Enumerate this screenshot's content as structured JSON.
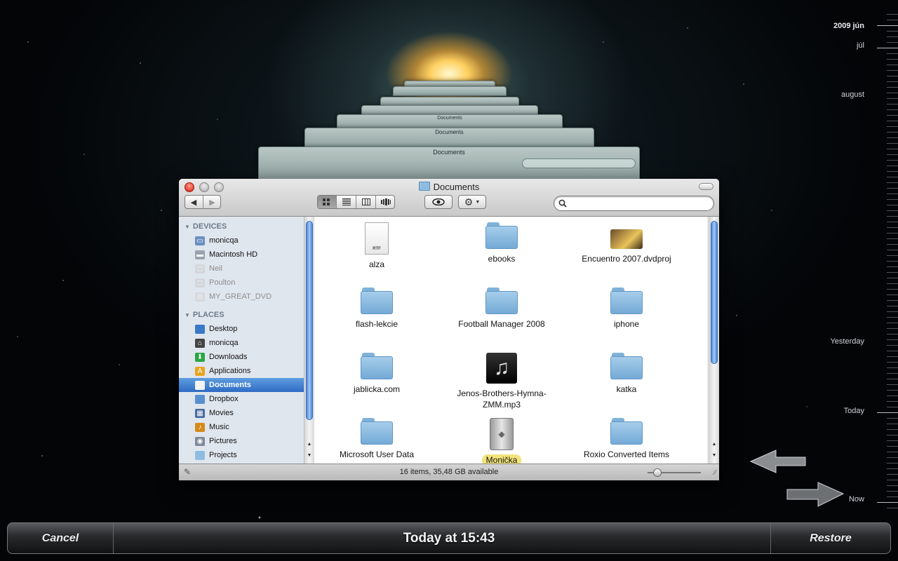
{
  "window": {
    "title": "Documents",
    "status": "16 items, 35,48 GB available"
  },
  "toolbar": {
    "back_icon": "◀",
    "forward_icon": "▶",
    "search_placeholder": ""
  },
  "sidebar": {
    "devices_header": "DEVICES",
    "devices": [
      {
        "label": "monicqa",
        "icon": "laptop-icon",
        "dim": false
      },
      {
        "label": "Macintosh HD",
        "icon": "harddisk-icon",
        "dim": false
      },
      {
        "label": "Neil",
        "icon": "disk-icon",
        "dim": true
      },
      {
        "label": "Poulton",
        "icon": "disk-icon",
        "dim": true
      },
      {
        "label": "MY_GREAT_DVD",
        "icon": "dvd-icon",
        "dim": true
      }
    ],
    "places_header": "PLACES",
    "places": [
      {
        "label": "Desktop",
        "icon": "desktop-icon"
      },
      {
        "label": "monicqa",
        "icon": "home-icon"
      },
      {
        "label": "Downloads",
        "icon": "downloads-icon"
      },
      {
        "label": "Applications",
        "icon": "applications-icon"
      },
      {
        "label": "Documents",
        "icon": "documents-icon",
        "selected": true
      },
      {
        "label": "Dropbox",
        "icon": "dropbox-icon"
      },
      {
        "label": "Movies",
        "icon": "movies-icon"
      },
      {
        "label": "Music",
        "icon": "music-icon"
      },
      {
        "label": "Pictures",
        "icon": "pictures-icon"
      },
      {
        "label": "Projects",
        "icon": "folder-icon"
      }
    ]
  },
  "files": [
    {
      "name": "alza",
      "icon": "rtf-file-icon",
      "badge": "RTF"
    },
    {
      "name": "ebooks",
      "icon": "folder-icon"
    },
    {
      "name": "Encuentro 2007.dvdproj",
      "icon": "dvdproj-file-icon"
    },
    {
      "name": "flash-lekcie",
      "icon": "folder-icon"
    },
    {
      "name": "Football Manager 2008",
      "icon": "folder-icon"
    },
    {
      "name": "iphone",
      "icon": "folder-icon"
    },
    {
      "name": "jablicka.com",
      "icon": "folder-icon"
    },
    {
      "name": "Jenos-Brothers-Hymna-ZMM.mp3",
      "name_line1": "Jenos-Brothers-Hymna-",
      "name_line2": "ZMM.mp3",
      "icon": "mp3-file-icon"
    },
    {
      "name": "katka",
      "icon": "folder-icon"
    },
    {
      "name": "Microsoft User Data",
      "icon": "folder-icon"
    },
    {
      "name": "Monička",
      "icon": "mac-pro-icon",
      "highlighted": true
    },
    {
      "name": "Roxio Converted Items",
      "icon": "folder-icon"
    }
  ],
  "timeline": {
    "labels": [
      {
        "text": "2009 jún",
        "year": true
      },
      {
        "text": "júl"
      },
      {
        "text": "august"
      },
      {
        "text": "Yesterday"
      },
      {
        "text": "Today"
      },
      {
        "text": "Now"
      }
    ]
  },
  "bottom_bar": {
    "cancel": "Cancel",
    "time": "Today at 15:43",
    "restore": "Restore"
  },
  "colors": {
    "selection": "#2f6bc4",
    "highlight_label": "#f2e37a",
    "folder": "#8fbde0"
  }
}
